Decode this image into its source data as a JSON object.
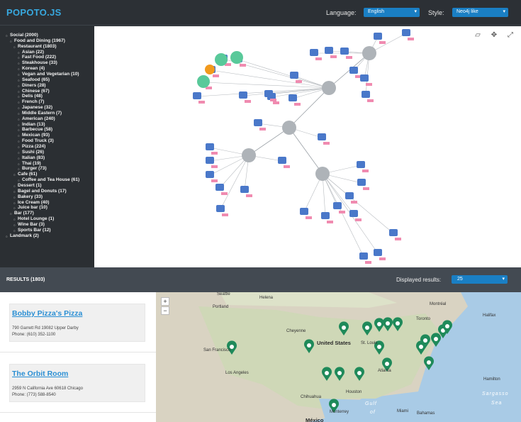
{
  "header": {
    "title": "POPOTO.JS",
    "language_label": "Language:",
    "language_value": "English",
    "style_label": "Style:",
    "style_value": "Neo4j like"
  },
  "taxonomy": [
    {
      "label": "Social (2000)",
      "level": 0
    },
    {
      "label": "Food and Dining (1967)",
      "level": 1
    },
    {
      "label": "Restaurant (1803)",
      "level": 2
    },
    {
      "label": "Asian (22)",
      "level": 3
    },
    {
      "label": "Fast Food (222)",
      "level": 3
    },
    {
      "label": "Steakhouse (33)",
      "level": 3
    },
    {
      "label": "Korean (4)",
      "level": 3
    },
    {
      "label": "Vegan and Vegetarian (10)",
      "level": 3
    },
    {
      "label": "Seafood (65)",
      "level": 3
    },
    {
      "label": "Diners (28)",
      "level": 3
    },
    {
      "label": "Chinese (67)",
      "level": 3
    },
    {
      "label": "Delis (48)",
      "level": 3
    },
    {
      "label": "French (7)",
      "level": 3
    },
    {
      "label": "Japanese (32)",
      "level": 3
    },
    {
      "label": "Middle Eastern (7)",
      "level": 3
    },
    {
      "label": "American (240)",
      "level": 3
    },
    {
      "label": "Indian (13)",
      "level": 3
    },
    {
      "label": "Barbecue (58)",
      "level": 3
    },
    {
      "label": "Mexican (93)",
      "level": 3
    },
    {
      "label": "Food Truck (3)",
      "level": 3
    },
    {
      "label": "Pizza (224)",
      "level": 3
    },
    {
      "label": "Sushi (26)",
      "level": 3
    },
    {
      "label": "Italian (83)",
      "level": 3
    },
    {
      "label": "Thai (19)",
      "level": 3
    },
    {
      "label": "Burger (73)",
      "level": 3
    },
    {
      "label": "Cafe (61)",
      "level": 2
    },
    {
      "label": "Coffee and Tea House (61)",
      "level": 3
    },
    {
      "label": "Dessert (1)",
      "level": 2
    },
    {
      "label": "Bagel and Donuts (17)",
      "level": 2
    },
    {
      "label": "Bakery (33)",
      "level": 2
    },
    {
      "label": "Ice Cream (40)",
      "level": 2
    },
    {
      "label": "Juice bar (10)",
      "level": 2
    },
    {
      "label": "Bar (177)",
      "level": 1
    },
    {
      "label": "Hotel Lounge (1)",
      "level": 2
    },
    {
      "label": "Wine Bar (3)",
      "level": 2
    },
    {
      "label": "Sports Bar (12)",
      "level": 2
    },
    {
      "label": "Landmark (2)",
      "level": 0
    }
  ],
  "graph": {
    "toolbar_icons": [
      "reset-icon",
      "center-icon",
      "fullscreen-icon"
    ],
    "hub_color": "#aeb3b8",
    "node_color": "#4a78c9",
    "badge_color": "#f08bb0",
    "selected_color": "#59c99a"
  },
  "results_bar": {
    "title": "RESULTS (1803)",
    "displayed_label": "Displayed results:",
    "displayed_value": "25"
  },
  "results": [
    {
      "name": "Bobby Pizza's Pizza",
      "address": "790 Garrett Rd 19082 Upper Darby",
      "phone": "Phone: (610) 352-1100"
    },
    {
      "name": "The Orbit Room",
      "address": "2959 N California Ave 60618 Chicago",
      "phone": "Phone: (773) 588-8540"
    }
  ],
  "map": {
    "zoom_in": "+",
    "zoom_out": "−",
    "labels": [
      {
        "text": "Seattle",
        "class": ""
      },
      {
        "text": "Helena",
        "class": ""
      },
      {
        "text": "Portland",
        "class": ""
      },
      {
        "text": "Montréal",
        "class": ""
      },
      {
        "text": "Toronto",
        "class": ""
      },
      {
        "text": "Halifax",
        "class": ""
      },
      {
        "text": "Cheyenne",
        "class": ""
      },
      {
        "text": "United States",
        "class": "big"
      },
      {
        "text": "St. Louis",
        "class": ""
      },
      {
        "text": "San Francisco",
        "class": ""
      },
      {
        "text": "Los Angeles",
        "class": ""
      },
      {
        "text": "Atlanta",
        "class": ""
      },
      {
        "text": "Hamilton",
        "class": ""
      },
      {
        "text": "Sargasso",
        "class": "sea"
      },
      {
        "text": "Sea",
        "class": "sea"
      },
      {
        "text": "Houston",
        "class": ""
      },
      {
        "text": "Chihuahua",
        "class": ""
      },
      {
        "text": "Gulf",
        "class": "sea"
      },
      {
        "text": "of",
        "class": "sea"
      },
      {
        "text": "Monterrey",
        "class": ""
      },
      {
        "text": "Miami",
        "class": ""
      },
      {
        "text": "Bahamas",
        "class": ""
      },
      {
        "text": "México",
        "class": "big"
      }
    ],
    "marker_color": "#1f8a5a"
  }
}
